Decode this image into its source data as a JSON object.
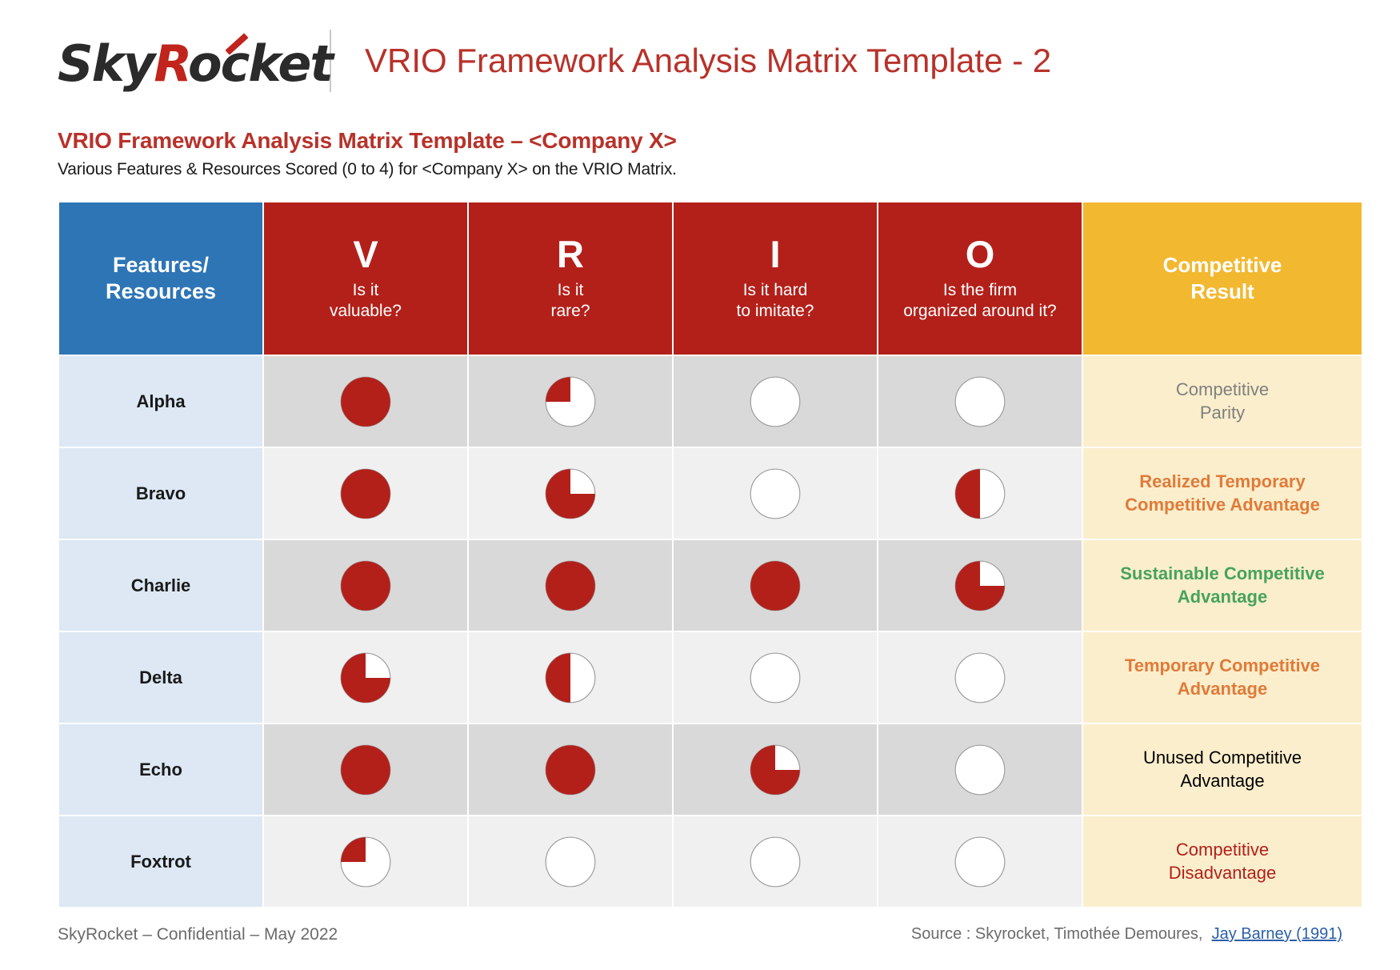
{
  "brand": {
    "logo_text_1": "Sky",
    "logo_text_r": "R",
    "logo_text_2": "ocket",
    "accent_color": "#c0241c",
    "divider_icon": "vertical-divider"
  },
  "header": {
    "document_title": "VRIO Framework Analysis Matrix Template - 2"
  },
  "slide": {
    "headline": "VRIO Framework Analysis Matrix Template – <Company X>",
    "subheadline": "Various Features & Resources Scored (0 to 4) for <Company X> on the VRIO Matrix."
  },
  "table": {
    "columns": [
      {
        "key": "name",
        "letter": "",
        "title": "Features/\nResources",
        "title_line1": "Features/",
        "title_line2": "Resources",
        "question": "",
        "bg": "#2e75b6"
      },
      {
        "key": "v",
        "letter": "V",
        "question_line1": "Is it",
        "question_line2": "valuable?",
        "bg": "#b3201a"
      },
      {
        "key": "r",
        "letter": "R",
        "question_line1": "Is it",
        "question_line2": "rare?",
        "bg": "#b3201a"
      },
      {
        "key": "i",
        "letter": "I",
        "question_line1": "Is it hard",
        "question_line2": "to imitate?",
        "bg": "#b3201a"
      },
      {
        "key": "o",
        "letter": "O",
        "question_line1": "Is the firm",
        "question_line2": "organized around it?",
        "bg": "#b3201a"
      },
      {
        "key": "result",
        "letter": "",
        "title_line1": "Competitive",
        "title_line2": "Result",
        "bg": "#f2b830"
      }
    ],
    "score_scale": {
      "min": 0,
      "max": 4,
      "fill_color": "#b3201a",
      "empty_color": "#ffffff",
      "stroke_color": "#9e9e9e"
    },
    "rows": [
      {
        "name": "Alpha",
        "scores": {
          "v": 4,
          "r": 1,
          "i": 0,
          "o": 0
        },
        "result_line1": "Competitive",
        "result_line2": "Parity",
        "result_color": "#7f7f7f",
        "result_bold": false
      },
      {
        "name": "Bravo",
        "scores": {
          "v": 4,
          "r": 3,
          "i": 0,
          "o": 2
        },
        "result_line1": "Realized Temporary",
        "result_line2": "Competitive Advantage",
        "result_color": "#e07b39",
        "result_bold": true
      },
      {
        "name": "Charlie",
        "scores": {
          "v": 4,
          "r": 4,
          "i": 4,
          "o": 3
        },
        "result_line1": "Sustainable Competitive",
        "result_line2": "Advantage",
        "result_color": "#46a35e",
        "result_bold": true
      },
      {
        "name": "Delta",
        "scores": {
          "v": 3,
          "r": 2,
          "i": 0,
          "o": 0
        },
        "result_line1": "Temporary Competitive",
        "result_line2": "Advantage",
        "result_color": "#e07b39",
        "result_bold": true
      },
      {
        "name": "Echo",
        "scores": {
          "v": 4,
          "r": 4,
          "i": 3,
          "o": 0
        },
        "result_line1": "Unused Competitive",
        "result_line2": "Advantage",
        "result_color": "#000000",
        "result_bold": false
      },
      {
        "name": "Foxtrot",
        "scores": {
          "v": 1,
          "r": 0,
          "i": 0,
          "o": 0
        },
        "result_line1": "Competitive",
        "result_line2": "Disadvantage",
        "result_color": "#b3201a",
        "result_bold": false
      }
    ]
  },
  "footer": {
    "left": "SkyRocket – Confidential – May 2022",
    "source_label": "Source : Skyrocket, Timothée Demoures,",
    "source_link": "Jay Barney (1991)"
  },
  "chart_data": {
    "type": "table",
    "title": "VRIO Framework Analysis Matrix Template – <Company X>",
    "subtitle": "Various Features & Resources Scored (0 to 4) for <Company X> on the VRIO Matrix.",
    "categories": [
      "Alpha",
      "Bravo",
      "Charlie",
      "Delta",
      "Echo",
      "Foxtrot"
    ],
    "series": [
      {
        "name": "V (Is it valuable?)",
        "values": [
          4,
          4,
          4,
          3,
          4,
          1
        ]
      },
      {
        "name": "R (Is it rare?)",
        "values": [
          1,
          3,
          4,
          2,
          4,
          0
        ]
      },
      {
        "name": "I (Is it hard to imitate?)",
        "values": [
          0,
          0,
          4,
          0,
          3,
          0
        ]
      },
      {
        "name": "O (Is the firm organized around it?)",
        "values": [
          0,
          2,
          3,
          0,
          0,
          0
        ]
      }
    ],
    "annotations": [
      "Competitive Parity",
      "Realized Temporary Competitive Advantage",
      "Sustainable Competitive Advantage",
      "Temporary Competitive Advantage",
      "Unused Competitive Advantage",
      "Competitive Disadvantage"
    ],
    "ylim": [
      0,
      4
    ],
    "ylabel": "Score (0 to 4)",
    "xlabel": "Features/Resources",
    "grid": false,
    "legend": "top"
  }
}
